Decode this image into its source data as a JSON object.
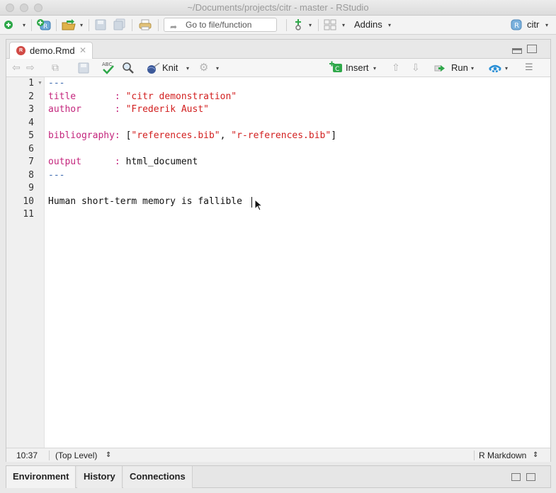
{
  "window": {
    "title": "~/Documents/projects/citr - master - RStudio"
  },
  "toolbar": {
    "goto_placeholder": "Go to file/function",
    "addins_label": "Addins",
    "project_label": "citr"
  },
  "source": {
    "tab_label": "demo.Rmd",
    "knit_label": "Knit",
    "insert_label": "Insert",
    "run_label": "Run"
  },
  "editor": {
    "line_numbers": [
      "1",
      "2",
      "3",
      "4",
      "5",
      "6",
      "7",
      "8",
      "9",
      "10",
      "11"
    ],
    "lines": {
      "l1": "---",
      "l2_key": "title",
      "l2_sep": "       : ",
      "l2_val": "\"citr demonstration\"",
      "l3_key": "author",
      "l3_sep": "      : ",
      "l3_val": "\"Frederik Aust\"",
      "l5_key": "bibliography:",
      "l5_open": " [",
      "l5_val1": "\"references.bib\"",
      "l5_comma": ", ",
      "l5_val2": "\"r-references.bib\"",
      "l5_close": "]",
      "l7_key": "output",
      "l7_sep": "      : ",
      "l7_val": "html_document",
      "l8": "---",
      "l10": "Human short-term memory is fallible "
    }
  },
  "status": {
    "position": "10:37",
    "scope": "(Top Level)",
    "mode": "R Markdown"
  },
  "bottom_tabs": [
    "Environment",
    "History",
    "Connections"
  ],
  "colors": {
    "yaml_key": "#c4267d",
    "string": "#d21f1f",
    "delimiter": "#3a68ae"
  }
}
